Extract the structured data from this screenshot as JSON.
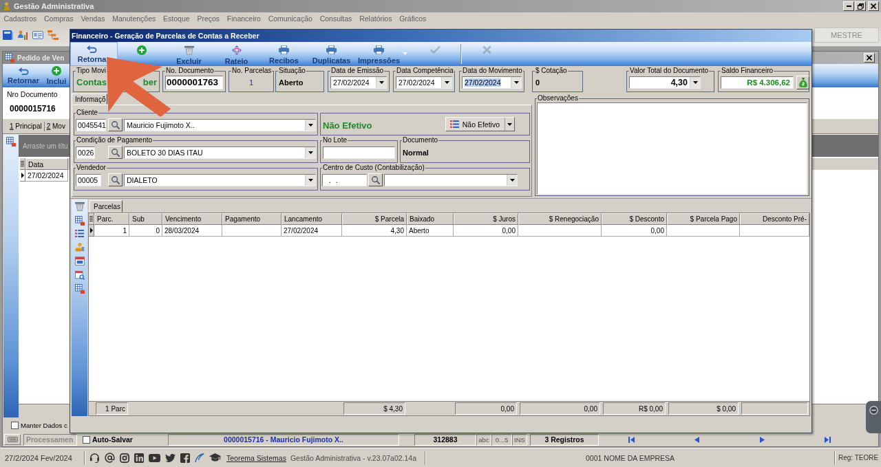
{
  "app": {
    "title": "Gestão Administrativa",
    "menu": [
      "Cadastros",
      "Compras",
      "Vendas",
      "Manutenções",
      "Estoque",
      "Preços",
      "Financeiro",
      "Comunicação",
      "Consultas",
      "Relatórios",
      "Gráficos"
    ],
    "user": "MESTRE"
  },
  "background_window": {
    "title": "Pedido de Ven",
    "toolbar": [
      {
        "label": "Retornar",
        "kind": "return"
      },
      {
        "label": "Inclui",
        "kind": "add"
      }
    ],
    "document_label": "Nro Documento",
    "document_number": "0000015716",
    "tabs": [
      "1 Principal",
      "2 Mov"
    ],
    "group_hint": "Arraste um títu",
    "columns": [
      "Data"
    ],
    "rows": [
      {
        "current": true,
        "cells": [
          "27/02/2024"
        ]
      }
    ],
    "keep_data": {
      "label": "Manter Dados c",
      "checked": false
    },
    "status_row": {
      "process": "Processamen",
      "auto_save": {
        "label": "Auto-Salvar",
        "checked": false
      },
      "record": "0000015716 - Mauricio Fujimoto X..",
      "code": "312883",
      "flags": [
        "abc",
        "0...5",
        "INS"
      ],
      "count": "3 Registros"
    }
  },
  "dialog": {
    "title": "Financeiro - Geração de Parcelas de Contas a Receber",
    "toolbar": [
      {
        "label": "Retorna",
        "kind": "return",
        "highlighted": true,
        "disabled": false,
        "dropdown": false
      },
      {
        "kind": "add",
        "highlighted": false,
        "disabled": false,
        "dropdown": false
      },
      {
        "label": "Excluir",
        "kind": "delete",
        "highlighted": false,
        "disabled": false,
        "dropdown": false
      },
      {
        "label": "Rateio",
        "kind": "split",
        "highlighted": false,
        "disabled": false,
        "dropdown": false
      },
      {
        "label": "Recibos",
        "kind": "print",
        "highlighted": false,
        "disabled": false,
        "dropdown": false
      },
      {
        "label": "Duplicatas",
        "kind": "print",
        "highlighted": false,
        "disabled": false,
        "dropdown": false
      },
      {
        "label": "Impressões",
        "kind": "print",
        "highlighted": false,
        "disabled": false,
        "dropdown": true
      },
      {
        "kind": "confirm",
        "highlighted": false,
        "disabled": true,
        "dropdown": false
      },
      {
        "kind": "cancel",
        "highlighted": false,
        "disabled": true,
        "dropdown": false
      }
    ],
    "header_fields": [
      {
        "kind": "type",
        "label": "Tipo Movi",
        "value_parts": [
          "Contas",
          "ber"
        ]
      },
      {
        "kind": "input",
        "label": "No. Documento",
        "value": "0000001763"
      },
      {
        "kind": "count",
        "label": "No. Parcelas",
        "value": "1"
      },
      {
        "kind": "status",
        "label": "Situação",
        "value": "Aberto"
      },
      {
        "kind": "date",
        "label": "Data de Emissão",
        "value": "27/02/2024",
        "focused": false
      },
      {
        "kind": "date",
        "label": "Data Competência",
        "value": "27/02/2024",
        "focused": false
      },
      {
        "kind": "date",
        "label": "Data do Movimento",
        "value": "27/02/2024",
        "focused": true
      },
      {
        "kind": "status",
        "label": "$ Cotação",
        "value": "0"
      },
      {
        "kind": "amount",
        "label": "Valor Total do Documento",
        "value": "4,30"
      },
      {
        "kind": "balance",
        "label": "Saldo Financeiro",
        "value": "R$ 4.306,62"
      }
    ],
    "info_tab": "Informaçõ",
    "client": {
      "label": "Cliente",
      "code": "0045541",
      "name": "Mauricio Fujimoto X.."
    },
    "effective": {
      "status": "Não Efetivo",
      "button": "Não Efetivo"
    },
    "payment": {
      "label": "Condição de Pagamento",
      "code": "0026",
      "name": "BOLETO 30 DIAS ITAU"
    },
    "batch": {
      "label": "No Lote"
    },
    "document": {
      "label": "Documento",
      "value": "Normal"
    },
    "seller": {
      "label": "Vendedor",
      "code": "00005",
      "name": "DIALETO"
    },
    "cost_center": {
      "label": "Centro de Custo (Contabilização)",
      "code": ". ."
    },
    "notes": {
      "label": "Observações"
    },
    "installments": {
      "tab": "Parcelas",
      "columns": [
        "Parc.",
        "Sub",
        "Vencimento",
        "Pagamento",
        "Lancamento",
        "$ Parcela",
        "Baixado",
        "$ Juros",
        "$ Renegociação",
        "$ Desconto",
        "$ Parcela Pago",
        "Desconto Pré-"
      ],
      "rows": [
        {
          "current": true,
          "cells": [
            "1",
            "0",
            "28/03/2024",
            null,
            "27/02/2024",
            "4,30",
            "Aberto",
            "0,00",
            null,
            "0,00",
            null,
            null
          ]
        }
      ],
      "totals": [
        "1 Parc",
        "$ 4,30",
        "0,00",
        "0,00",
        "R$ 0,00",
        "$ 0,00"
      ]
    }
  },
  "status_bar": {
    "date": "27/2/2024 Fev/2024",
    "link": "Teorema Sistemas",
    "version": "Gestão Administrativa - v.23.07a02.14a",
    "company": "0001 NOME DA EMPRESA",
    "registration": "Reg: TEORE"
  }
}
